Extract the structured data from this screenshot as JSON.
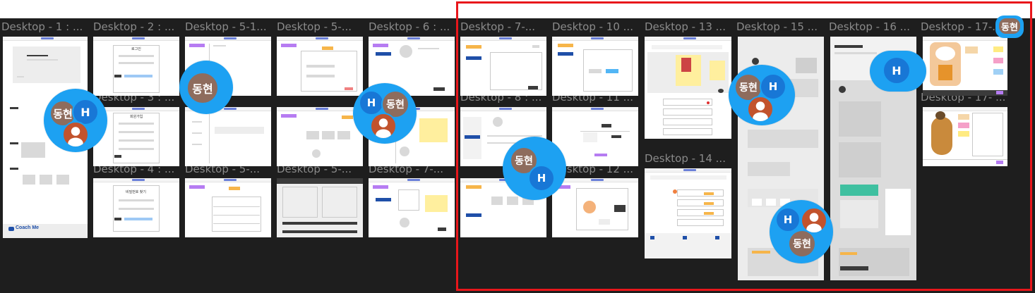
{
  "frames": [
    {
      "id": "f1",
      "label": "Desktop - 1 : ..."
    },
    {
      "id": "f2",
      "label": "Desktop - 2 : ..."
    },
    {
      "id": "f51",
      "label": "Desktop - 5-1..."
    },
    {
      "id": "f5a",
      "label": "Desktop - 5-..."
    },
    {
      "id": "f6",
      "label": "Desktop - 6 : ..."
    },
    {
      "id": "f7",
      "label": "Desktop - 7-..."
    },
    {
      "id": "f10",
      "label": "Desktop - 10 ..."
    },
    {
      "id": "f13",
      "label": "Desktop - 13 ..."
    },
    {
      "id": "f15",
      "label": "Desktop - 15 ..."
    },
    {
      "id": "f16",
      "label": "Desktop - 16 ..."
    },
    {
      "id": "f17",
      "label": "Desktop - 17-..."
    },
    {
      "id": "f3",
      "label": "Desktop - 3 : ..."
    },
    {
      "id": "f8",
      "label": "Desktop - 8 : ..."
    },
    {
      "id": "f11",
      "label": "Desktop - 11 ..."
    },
    {
      "id": "f17b",
      "label": "Desktop - 17- ..."
    },
    {
      "id": "f4",
      "label": "Desktop - 4 : ..."
    },
    {
      "id": "f5b",
      "label": "Desktop - 5-..."
    },
    {
      "id": "f5c",
      "label": "Desktop - 5-..."
    },
    {
      "id": "f7b",
      "label": "Desktop - 7-..."
    },
    {
      "id": "f12",
      "label": "Desktop - 12 ..."
    },
    {
      "id": "f14",
      "label": "Desktop - 14 ..."
    }
  ],
  "collaborators": {
    "donghyun": "동현",
    "h": "H"
  },
  "thumbnail_text": {
    "coachme": "Coach Me",
    "login": "로그인",
    "signup": "회원가입",
    "pwfind": "비밀번호 찾기"
  },
  "colors": {
    "canvas_bg": "#1e1e1e",
    "selection": "#e8161b",
    "cursor": "#1da1f2"
  }
}
